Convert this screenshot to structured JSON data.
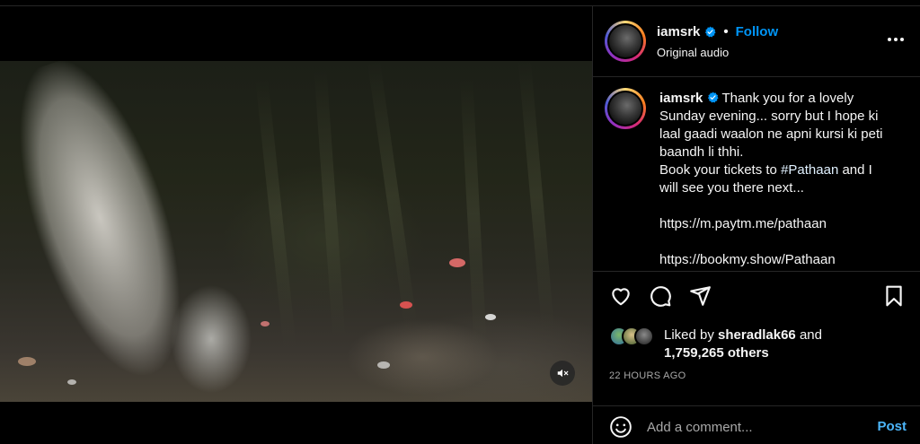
{
  "post": {
    "username": "iamsrk",
    "follow_label": "Follow",
    "dot": "•",
    "audio": "Original audio",
    "caption_username": "iamsrk",
    "caption_lines": [
      "Thank you for a lovely",
      "Sunday evening... sorry but I hope ki",
      "laal gaadi waalon ne apni kursi ki peti",
      "baandh li thhi."
    ],
    "caption_book_prefix": "Book your tickets to ",
    "caption_hashtag": "#Pathaan",
    "caption_book_suffix": " and I",
    "caption_book_line2": "will see you there next...",
    "link1": "https://m.paytm.me/pathaan",
    "link2": "https://bookmy.show/Pathaan",
    "liked_by_prefix": "Liked by ",
    "liked_by_user": "sheradlak66",
    "liked_by_and": " and",
    "liked_count": "1,759,265 others",
    "time_ago": "22 HOURS AGO"
  },
  "comment": {
    "placeholder": "Add a comment...",
    "post_label": "Post"
  },
  "icons": {
    "verified": "verified-badge-icon",
    "more": "more-options-icon",
    "like": "heart-icon",
    "comment": "comment-icon",
    "share": "share-icon",
    "save": "bookmark-icon",
    "emoji": "emoji-icon",
    "mute": "muted-speaker-icon"
  },
  "colors": {
    "accent": "#0095f6",
    "post_button": "#4cb5f9",
    "secondary_text": "#a8a8a8",
    "divider": "#262626"
  }
}
